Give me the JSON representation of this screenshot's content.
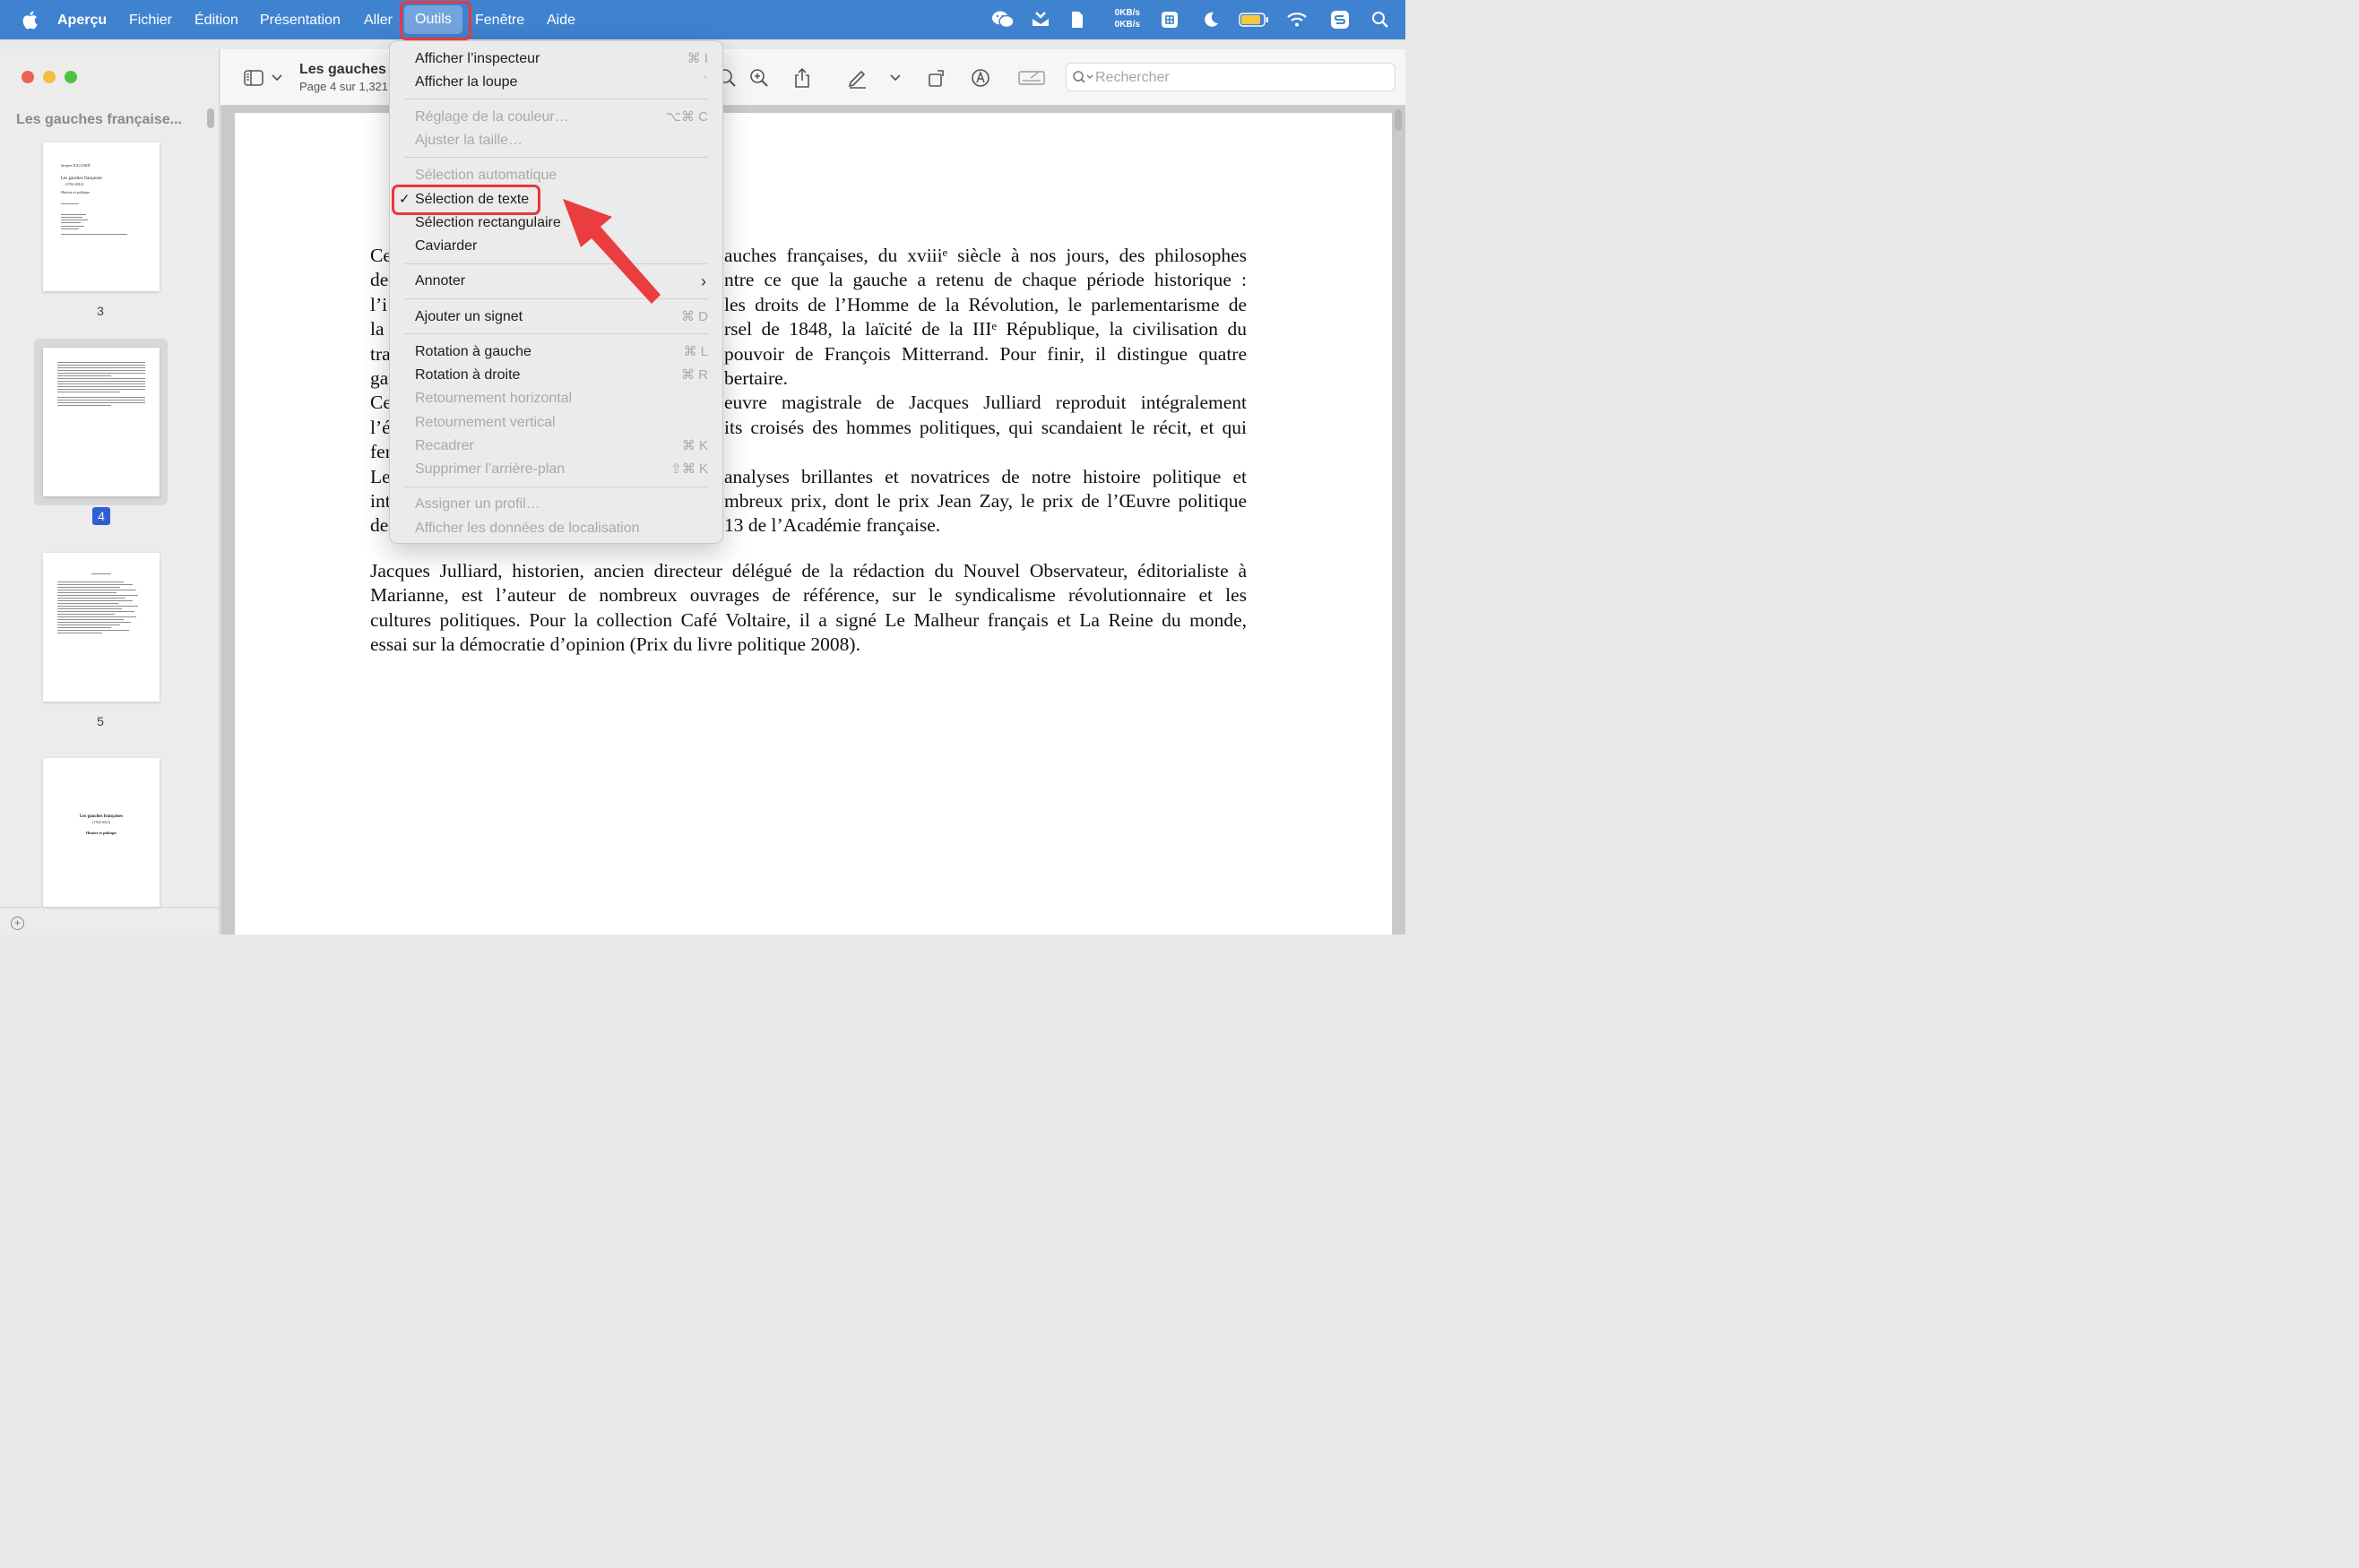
{
  "menubar": {
    "app_name": "Aperçu",
    "items": [
      "Fichier",
      "Édition",
      "Présentation",
      "Aller",
      "Outils",
      "Fenêtre",
      "Aide"
    ],
    "net_up": "0KB/s",
    "net_down": "0KB/s"
  },
  "sidebar": {
    "title": "Les gauches française...",
    "thumbnails": [
      {
        "page_label": "3"
      },
      {
        "page_label": "4",
        "selected": true
      },
      {
        "page_label": "5"
      },
      {
        "page_label": ""
      }
    ],
    "thumb3": {
      "author": "Jacques JULLIARD",
      "title": "Les gauches françaises",
      "years": "(1762-2012)",
      "subtitle": "Histoire et politique"
    },
    "thumb6": {
      "title": "Les gauches françaises",
      "years": "(1762-2012)",
      "subtitle": "Histoire et politique"
    }
  },
  "toolbar": {
    "doc_title": "Les gauches",
    "doc_subtitle": "Page 4 sur 1,321",
    "search_placeholder": "Rechercher"
  },
  "dropdown": {
    "items": [
      {
        "label": "Afficher l’inspecteur",
        "shortcut": "⌘ I",
        "enabled": true
      },
      {
        "label": "Afficher la loupe",
        "shortcut": "`",
        "enabled": true
      },
      {
        "label": "Réglage de la couleur…",
        "shortcut": "⌥⌘ C",
        "enabled": false
      },
      {
        "label": "Ajuster la taille…",
        "shortcut": "",
        "enabled": false
      },
      {
        "label": "Sélection automatique",
        "shortcut": "",
        "enabled": false
      },
      {
        "label": "Sélection de texte",
        "shortcut": "",
        "enabled": true,
        "checked": true
      },
      {
        "label": "Sélection rectangulaire",
        "shortcut": "",
        "enabled": true
      },
      {
        "label": "Caviarder",
        "shortcut": "",
        "enabled": true
      },
      {
        "label": "Annoter",
        "shortcut": "",
        "enabled": true,
        "submenu": true
      },
      {
        "label": "Ajouter un signet",
        "shortcut": "⌘ D",
        "enabled": true
      },
      {
        "label": "Rotation à gauche",
        "shortcut": "⌘ L",
        "enabled": true
      },
      {
        "label": "Rotation à droite",
        "shortcut": "⌘ R",
        "enabled": true
      },
      {
        "label": "Retournement horizontal",
        "shortcut": "",
        "enabled": false
      },
      {
        "label": "Retournement vertical",
        "shortcut": "",
        "enabled": false
      },
      {
        "label": "Recadrer",
        "shortcut": "⌘ K",
        "enabled": false
      },
      {
        "label": "Supprimer l’arrière-plan",
        "shortcut": "⇧⌘ K",
        "enabled": false
      },
      {
        "label": "Assigner un profil…",
        "shortcut": "",
        "enabled": false
      },
      {
        "label": "Afficher les données de localisation",
        "shortcut": "",
        "enabled": false
      }
    ]
  },
  "document": {
    "paragraph1": [
      {
        "left": "Ce",
        "right": "auches françaises, du xviiiᵉ siècle à nos jours, des philosophes"
      },
      {
        "left": "de",
        "right": "ntre ce que la gauche a retenu de chaque période historique :"
      },
      {
        "left": "l’i",
        "right": "les droits de l’Homme de la Révolution, le parlementarisme de"
      },
      {
        "left": "la",
        "right": "rsel de 1848, la laïcité de la IIIᵉ République, la civilisation du"
      },
      {
        "left": "tra",
        "right": "pouvoir de François Mitterrand. Pour finir, il distingue quatre"
      },
      {
        "left": "ga",
        "right": "bertaire."
      },
      {
        "left": "Ce",
        "right": "euvre magistrale de Jacques Julliard reproduit intégralement"
      },
      {
        "left": "l’é",
        "right": "its croisés des hommes politiques, qui scandaient le récit, et qui"
      },
      {
        "left": "fer",
        "right": ""
      },
      {
        "left": "Le",
        "right": "analyses brillantes et novatrices de notre histoire politique et"
      },
      {
        "left": "int",
        "right": "mbreux prix, dont le prix Jean Zay, le prix de l’Œuvre politique"
      },
      {
        "left": "de",
        "right": "13 de l’Académie française."
      }
    ],
    "paragraph2": [
      "Jacques Julliard, historien, ancien directeur délégué de la rédaction du Nouvel Observateur, éditorialiste à",
      "Marianne, est l’auteur de nombreux ouvrages de référence, sur le syndicalisme révolutionnaire et les",
      "cultures politiques. Pour la collection Café Voltaire, il a signé Le Malheur français et La Reine du monde,",
      "essai sur la démocratie d’opinion (Prix du livre politique 2008)."
    ]
  },
  "colors": {
    "menubar": "#3f82d0",
    "highlight": "#e8383b",
    "selected_page_badge": "#2d5fd3"
  }
}
